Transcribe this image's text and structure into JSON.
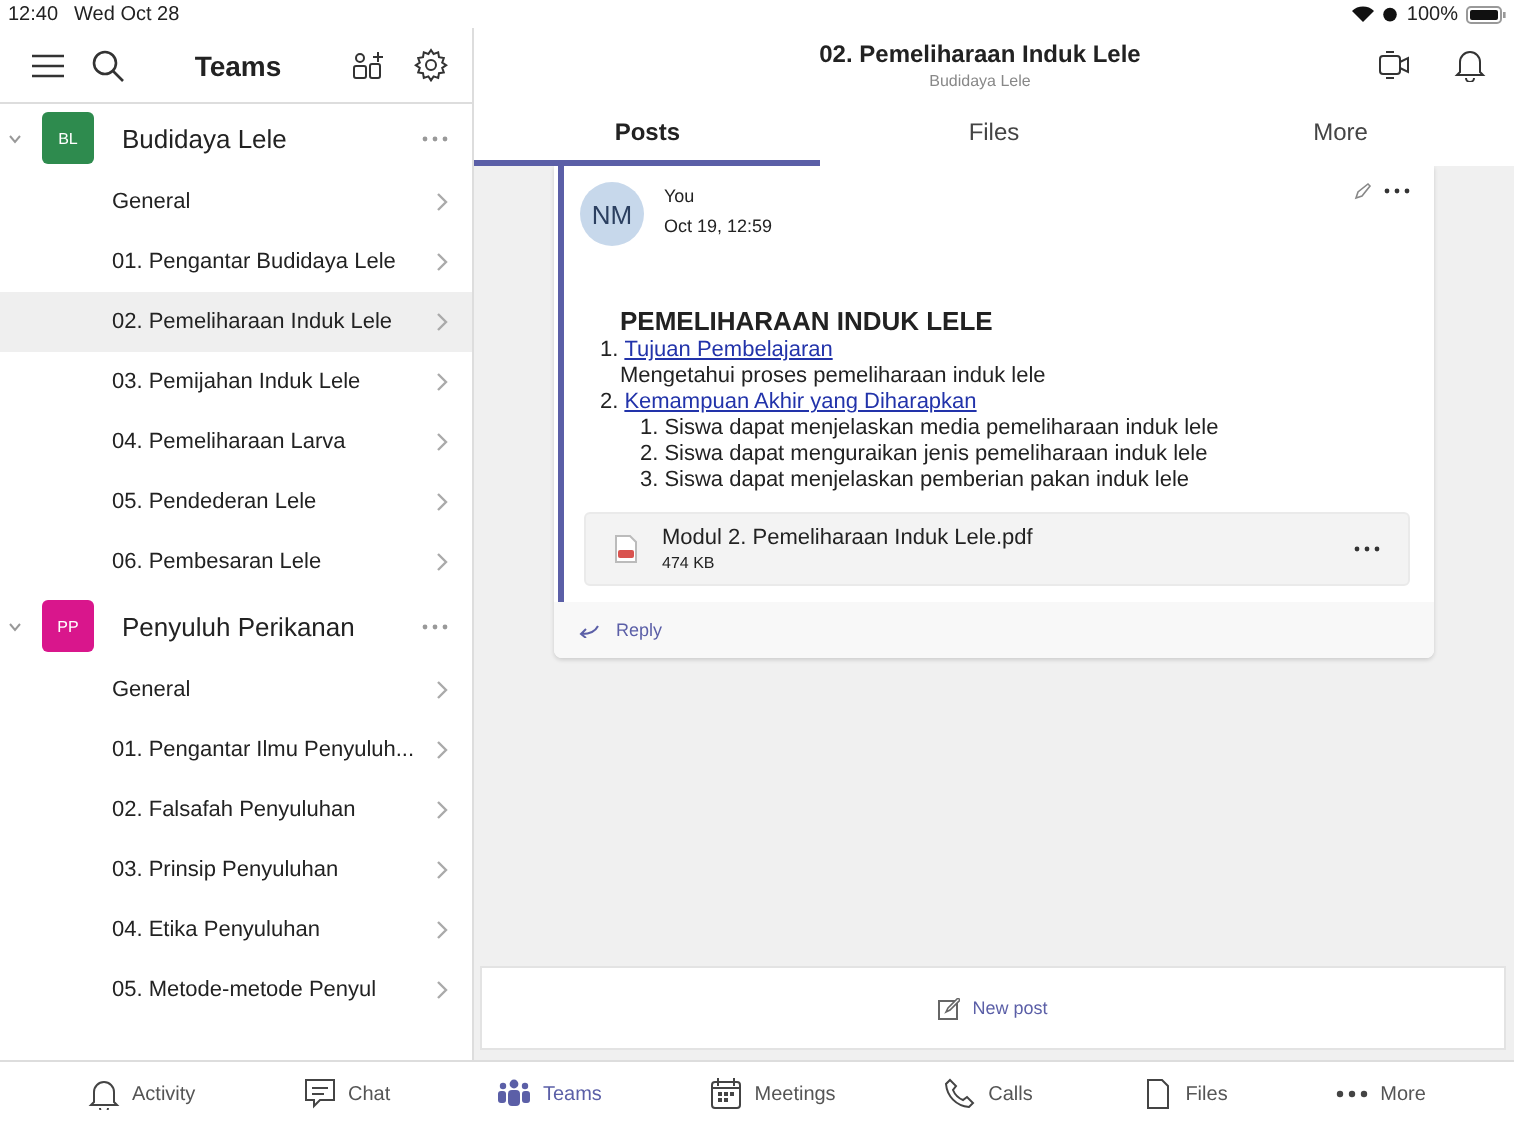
{
  "status_bar": {
    "time": "12:40",
    "date": "Wed Oct 28",
    "battery": "100%"
  },
  "sidebar": {
    "title": "Teams",
    "teams": [
      {
        "initials": "BL",
        "name": "Budidaya Lele",
        "color": "#2e8b4e",
        "expanded": true,
        "channels": [
          {
            "name": "General",
            "selected": false
          },
          {
            "name": "01. Pengantar Budidaya Lele",
            "selected": false
          },
          {
            "name": "02. Pemeliharaan Induk Lele",
            "selected": true
          },
          {
            "name": "03. Pemijahan Induk Lele",
            "selected": false
          },
          {
            "name": "04. Pemeliharaan Larva",
            "selected": false
          },
          {
            "name": "05. Pendederan Lele",
            "selected": false
          },
          {
            "name": "06. Pembesaran Lele",
            "selected": false
          }
        ]
      },
      {
        "initials": "PP",
        "name": "Penyuluh Perikanan",
        "color": "#d9168c",
        "expanded": true,
        "channels": [
          {
            "name": "General",
            "selected": false
          },
          {
            "name": "01. Pengantar Ilmu Penyuluh...",
            "selected": false
          },
          {
            "name": "02. Falsafah Penyuluhan",
            "selected": false
          },
          {
            "name": "03. Prinsip Penyuluhan",
            "selected": false
          },
          {
            "name": "04. Etika Penyuluhan",
            "selected": false
          },
          {
            "name": "05. Metode-metode Penyul",
            "selected": false
          }
        ]
      }
    ]
  },
  "channel": {
    "title": "02. Pemeliharaan Induk Lele",
    "team": "Budidaya Lele"
  },
  "tabs": [
    {
      "label": "Posts",
      "selected": true
    },
    {
      "label": "Files",
      "selected": false
    },
    {
      "label": "More",
      "selected": false
    }
  ],
  "post": {
    "initials": "NM",
    "author": "You",
    "time": "Oct 19, 12:59",
    "heading": "PEMELIHARAAN INDUK LELE",
    "sections": [
      {
        "number": "1.",
        "link": "Tujuan Pembelajaran",
        "text": "Mengetahui proses pemeliharaan induk lele"
      },
      {
        "number": "2.",
        "link": "Kemampuan Akhir yang Diharapkan",
        "items": [
          {
            "number": "1.",
            "text": "Siswa dapat menjelaskan media pemeliharaan induk lele"
          },
          {
            "number": "2.",
            "text": "Siswa dapat menguraikan jenis pemeliharaan induk lele"
          },
          {
            "number": "3.",
            "text": "Siswa dapat menjelaskan pemberian pakan induk lele"
          }
        ]
      }
    ],
    "attachment": {
      "name": "Modul 2. Pemeliharaan Induk Lele.pdf",
      "size": "474 KB"
    },
    "reply": "Reply"
  },
  "new_post": "New post",
  "bottom_nav": [
    {
      "kind": "activity",
      "label": "Activity",
      "selected": false
    },
    {
      "kind": "chat",
      "label": "Chat",
      "selected": false
    },
    {
      "kind": "teams",
      "label": "Teams",
      "selected": true
    },
    {
      "kind": "meetings",
      "label": "Meetings",
      "selected": false
    },
    {
      "kind": "calls",
      "label": "Calls",
      "selected": false
    },
    {
      "kind": "files",
      "label": "Files",
      "selected": false
    },
    {
      "kind": "more",
      "label": "More",
      "selected": false
    }
  ]
}
